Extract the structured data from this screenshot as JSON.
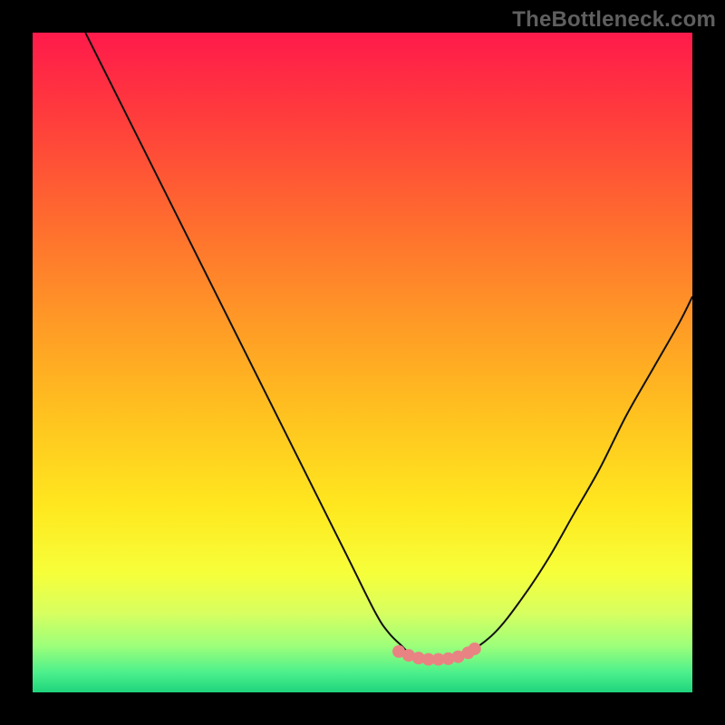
{
  "watermark": {
    "text": "TheBottleneck.com"
  },
  "colors": {
    "black": "#000000",
    "curve": "#111111",
    "marker_fill": "#e98383",
    "marker_stroke": "#e98383",
    "gradient_stops": [
      {
        "offset": 0.0,
        "color": "#ff1a4b"
      },
      {
        "offset": 0.12,
        "color": "#ff3a3d"
      },
      {
        "offset": 0.28,
        "color": "#ff6a2f"
      },
      {
        "offset": 0.44,
        "color": "#ff9a26"
      },
      {
        "offset": 0.58,
        "color": "#ffc21f"
      },
      {
        "offset": 0.72,
        "color": "#ffe81f"
      },
      {
        "offset": 0.82,
        "color": "#f6ff3a"
      },
      {
        "offset": 0.88,
        "color": "#d7ff60"
      },
      {
        "offset": 0.93,
        "color": "#9cff7a"
      },
      {
        "offset": 0.97,
        "color": "#4cf08c"
      },
      {
        "offset": 1.0,
        "color": "#1fd47c"
      }
    ]
  },
  "chart_data": {
    "type": "line",
    "title": "",
    "xlabel": "",
    "ylabel": "",
    "xlim": [
      0,
      100
    ],
    "ylim": [
      0,
      100
    ],
    "series": [
      {
        "name": "curve",
        "x": [
          8,
          12,
          16,
          20,
          24,
          28,
          32,
          36,
          40,
          44,
          48,
          52,
          54,
          56,
          57,
          58,
          60,
          62,
          64,
          66,
          70,
          74,
          78,
          82,
          86,
          90,
          94,
          98,
          100
        ],
        "y": [
          100,
          92,
          84,
          76,
          68,
          60,
          52,
          44,
          36,
          28,
          20,
          12,
          9,
          7,
          6,
          5.5,
          5,
          5,
          5.3,
          6,
          9,
          14,
          20,
          27,
          34,
          42,
          49,
          56,
          60
        ]
      }
    ],
    "markers": {
      "name": "flat-region",
      "x": [
        55.5,
        57,
        58.5,
        60,
        61.5,
        63,
        64.5,
        66,
        67
      ],
      "y": [
        6.2,
        5.6,
        5.2,
        5.0,
        5.0,
        5.1,
        5.4,
        6.0,
        6.6
      ]
    }
  }
}
